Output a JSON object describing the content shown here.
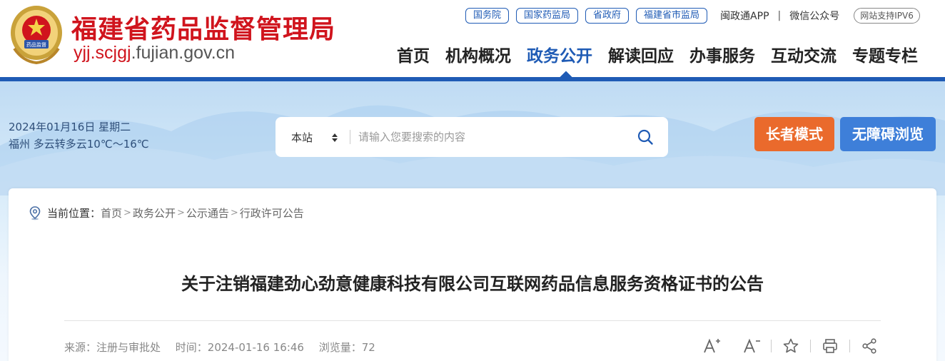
{
  "header": {
    "site_name": "福建省药品监督管理局",
    "domain_red": "yjj.scjgj",
    "domain_rest": ".fujian.gov.cn",
    "emblem_text": "药品监督",
    "top_links": [
      "国务院",
      "国家药监局",
      "省政府",
      "福建省市监局"
    ],
    "app_link": "闽政通APP",
    "separator": "|",
    "wechat_link": "微信公众号",
    "ipv6_badge": "网站支持IPV6",
    "nav": [
      "首页",
      "机构概况",
      "政务公开",
      "解读回应",
      "办事服务",
      "互动交流",
      "专题专栏"
    ],
    "active_nav": "政务公开"
  },
  "banner": {
    "date": "2024年01月16日 星期二",
    "weather": "福州 多云转多云10℃～16℃",
    "search": {
      "scope": "本站",
      "placeholder": "请输入您要搜索的内容"
    },
    "elder_mode": "长者模式",
    "accessible": "无障碍浏览"
  },
  "article": {
    "breadcrumb_label": "当前位置：",
    "breadcrumb": [
      "首页",
      "政务公开",
      "公示通告",
      "行政许可公告"
    ],
    "breadcrumb_sep": ">",
    "title": "关于注销福建劲心劲意健康科技有限公司互联网药品信息服务资格证书的公告",
    "source": "来源：注册与审批处",
    "time": "时间：2024-01-16 16:46",
    "views": "浏览量：72",
    "tools": [
      "A+",
      "A-"
    ]
  },
  "colors": {
    "brand_red": "#d0141d",
    "brand_blue": "#1f5bb5",
    "elder_orange": "#ea6a2c",
    "access_blue": "#3e7fd9"
  }
}
